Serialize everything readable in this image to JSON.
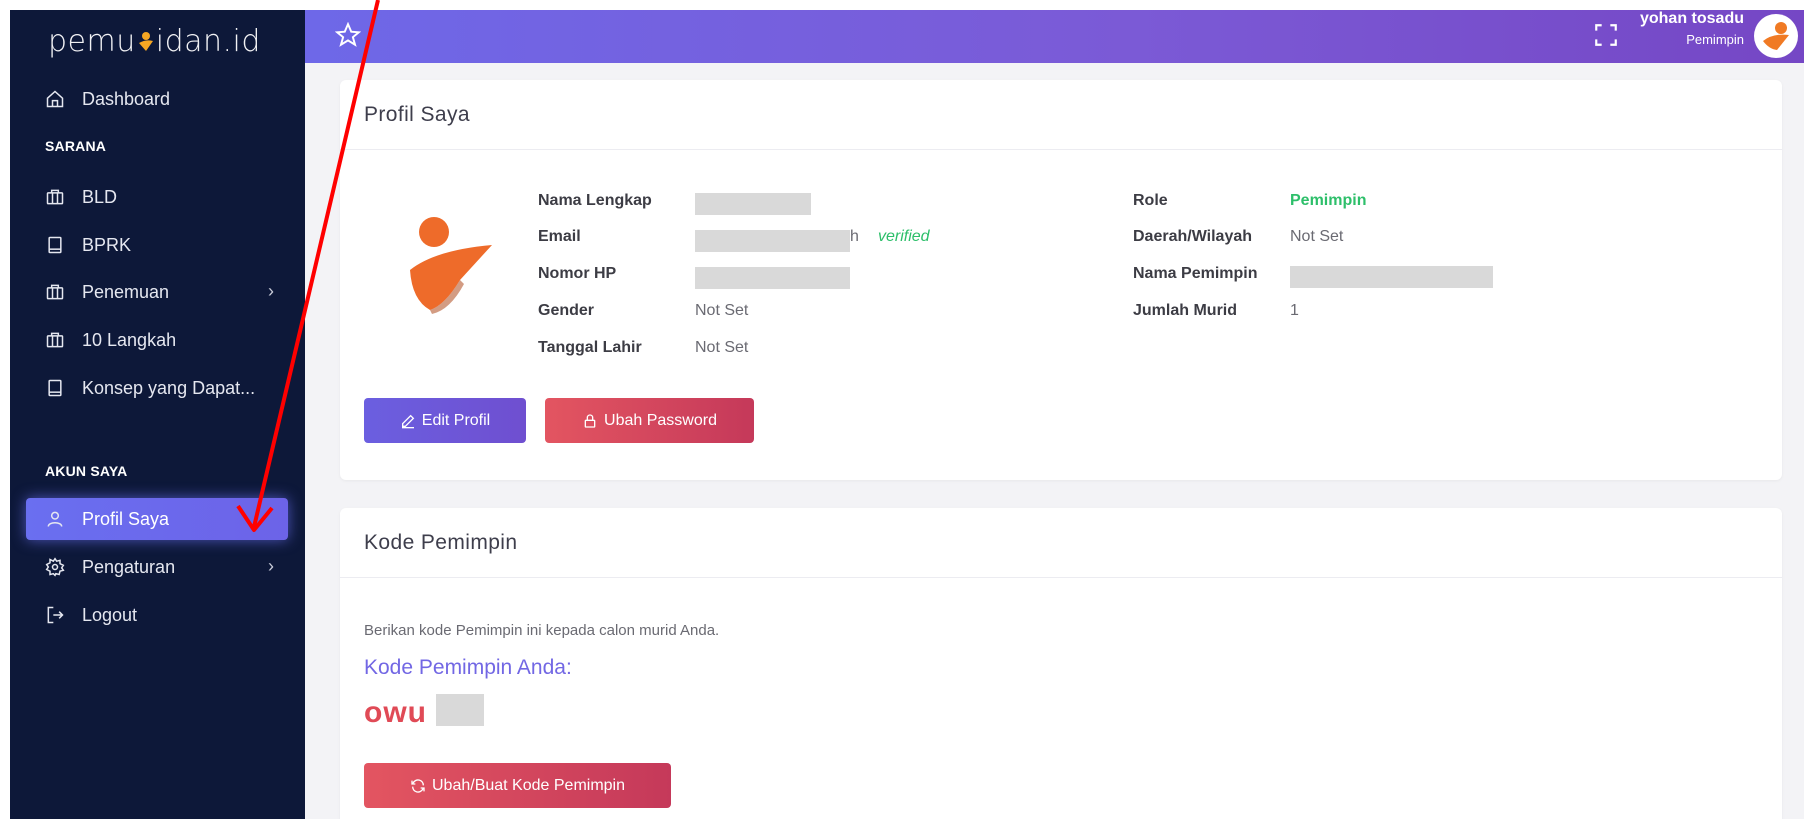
{
  "brand": {
    "logo_text_left": "pemu",
    "logo_text_right": "idan.id"
  },
  "sidebar": {
    "items": [
      {
        "label": "Dashboard",
        "icon": "home-icon"
      },
      {
        "label": "BLD",
        "icon": "briefcase-icon"
      },
      {
        "label": "BPRK",
        "icon": "book-icon"
      },
      {
        "label": "Penemuan",
        "icon": "briefcase-icon",
        "chevron": "›"
      },
      {
        "label": "10 Langkah",
        "icon": "briefcase-icon"
      },
      {
        "label": "Konsep yang Dapat...",
        "icon": "book-icon"
      },
      {
        "label": "Profil Saya",
        "icon": "user-icon",
        "active": true
      },
      {
        "label": "Pengaturan",
        "icon": "gear-icon",
        "chevron": "›"
      },
      {
        "label": "Logout",
        "icon": "logout-icon"
      }
    ],
    "sections": {
      "sarana": "SARANA",
      "akun": "AKUN SAYA"
    }
  },
  "topbar": {
    "user_name": "yohan tosadu",
    "user_role": "Pemimpin"
  },
  "profile": {
    "title": "Profil Saya",
    "left_fields": {
      "name_label": "Nama Lengkap",
      "email_label": "Email",
      "email_suffix": "h",
      "verified": "verified",
      "phone_label": "Nomor HP",
      "gender_label": "Gender",
      "gender_value": "Not Set",
      "dob_label": "Tanggal Lahir",
      "dob_value": "Not Set"
    },
    "right_fields": {
      "role_label": "Role",
      "role_value": "Pemimpin",
      "region_label": "Daerah/Wilayah",
      "region_value": "Not Set",
      "leader_label": "Nama Pemimpin",
      "students_label": "Jumlah Murid",
      "students_value": "1"
    },
    "edit_button": "Edit Profil",
    "password_button": "Ubah Password"
  },
  "kode": {
    "title": "Kode Pemimpin",
    "description": "Berikan kode Pemimpin ini kepada calon murid Anda.",
    "subtitle": "Kode Pemimpin Anda:",
    "code_visible": "owu",
    "button": "Ubah/Buat Kode Pemimpin"
  },
  "colors": {
    "sidebar_bg": "#0d1839",
    "accent": "#6b66ec",
    "danger": "#e04a56",
    "success": "#2dbf6a",
    "annotation": "#ff0000"
  }
}
